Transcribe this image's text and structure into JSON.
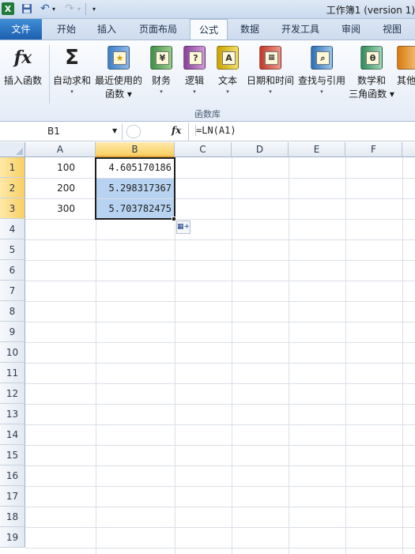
{
  "window": {
    "title": "工作簿1 (version 1)"
  },
  "quick_access": {
    "logo": "X",
    "save_icon": "floppy-icon",
    "undo_icon": "undo-icon",
    "redo_icon": "redo-icon"
  },
  "tabs": [
    {
      "label": "文件"
    },
    {
      "label": "开始"
    },
    {
      "label": "插入"
    },
    {
      "label": "页面布局"
    },
    {
      "label": "公式",
      "active": true
    },
    {
      "label": "数据"
    },
    {
      "label": "开发工具"
    },
    {
      "label": "审阅"
    },
    {
      "label": "视图"
    }
  ],
  "ribbon": {
    "group_label": "函数库",
    "buttons": [
      {
        "label": "插入函数",
        "icon": "fx-icon"
      },
      {
        "label": "自动求和",
        "icon": "sigma-icon"
      },
      {
        "label": "最近使用的",
        "label2": "函数",
        "icon": "recent-book-icon"
      },
      {
        "label": "财务",
        "icon": "finance-book-icon"
      },
      {
        "label": "逻辑",
        "icon": "logic-book-icon",
        "glyph": "?"
      },
      {
        "label": "文本",
        "icon": "text-book-icon",
        "glyph": "A"
      },
      {
        "label": "日期和时间",
        "icon": "datetime-book-icon"
      },
      {
        "label": "查找与引用",
        "icon": "lookup-book-icon"
      },
      {
        "label": "数学和",
        "label2": "三角函数",
        "icon": "math-book-icon",
        "glyph": "θ"
      },
      {
        "label": "其他",
        "icon": "more-book-icon"
      }
    ]
  },
  "formula_bar": {
    "name_box": "B1",
    "fx_label": "fx",
    "formula": "=LN(A1)"
  },
  "grid": {
    "columns": [
      "A",
      "B",
      "C",
      "D",
      "E",
      "F"
    ],
    "rows": [
      "1",
      "2",
      "3",
      "4",
      "5",
      "6",
      "7",
      "8",
      "9",
      "10",
      "11",
      "12",
      "13",
      "14",
      "15",
      "16",
      "17",
      "18",
      "19"
    ],
    "column_a_values": [
      "100",
      "200",
      "300"
    ],
    "column_b_values": [
      "4.605170186",
      "5.298317367",
      "5.703782475"
    ],
    "selected_column": "B"
  },
  "colors": {
    "selection_fill": "#b8d3f1",
    "header_highlight": "#f9cf63",
    "file_tab": "#2a6fc2"
  }
}
